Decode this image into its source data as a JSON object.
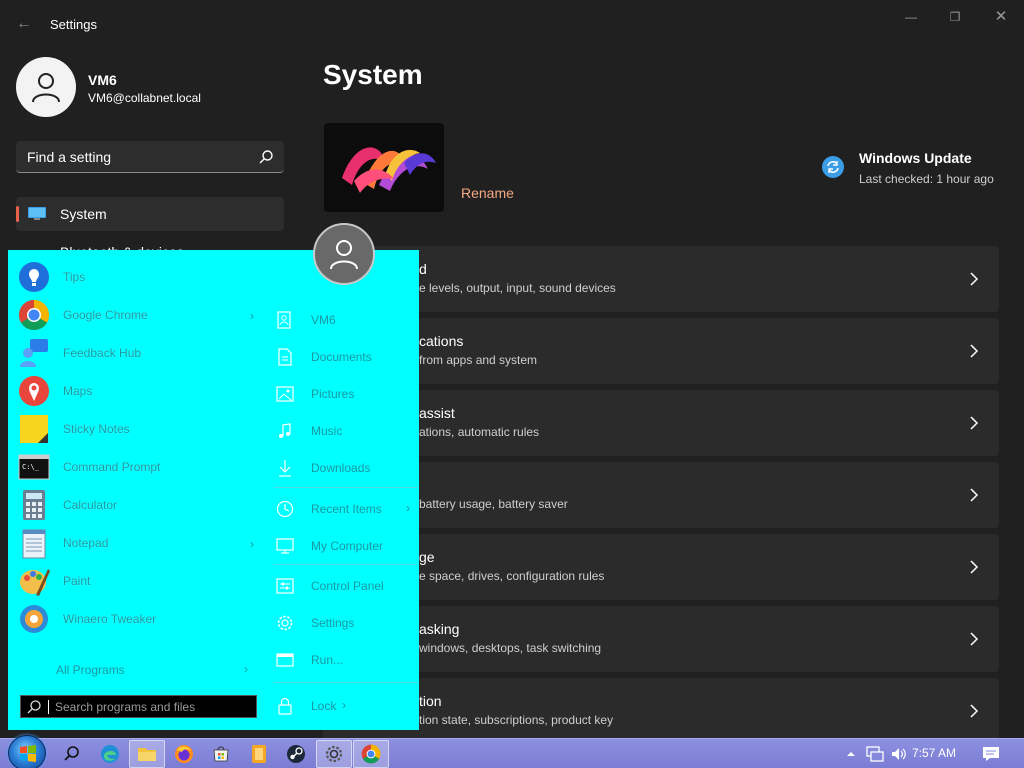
{
  "window": {
    "app_title": "Settings",
    "back_glyph": "←",
    "minimize_glyph": "—",
    "maximize_glyph": "❐",
    "close_glyph": "✕"
  },
  "profile": {
    "name": "VM6",
    "email": "VM6@collabnet.local"
  },
  "search": {
    "placeholder": "Find a setting"
  },
  "nav": {
    "selected": {
      "label": "System",
      "icon": "monitor-icon"
    },
    "next_partial": {
      "label": "Bluetooth & devices"
    }
  },
  "page": {
    "title": "System",
    "rename_label": "Rename",
    "windows_update": {
      "title": "Windows Update",
      "subtitle": "Last checked: 1 hour ago"
    }
  },
  "cards": [
    {
      "title": "d",
      "subtitle": "e levels, output, input, sound devices"
    },
    {
      "title": "cations",
      "subtitle": "from apps and system"
    },
    {
      "title": "assist",
      "subtitle": "ations, automatic rules"
    },
    {
      "title": "",
      "subtitle": "battery usage, battery saver"
    },
    {
      "title": "ge",
      "subtitle": "e space, drives, configuration rules"
    },
    {
      "title": "asking",
      "subtitle": "windows, desktops, task switching"
    },
    {
      "title": "tion",
      "subtitle": "tion state, subscriptions, product key"
    }
  ],
  "start_menu": {
    "pinned": [
      {
        "label": "Tips",
        "icon": "tips-icon",
        "has_arrow": false
      },
      {
        "label": "Google Chrome",
        "icon": "chrome-icon",
        "has_arrow": true
      },
      {
        "label": "Feedback Hub",
        "icon": "feedback-hub-icon",
        "has_arrow": false
      },
      {
        "label": "Maps",
        "icon": "maps-icon",
        "has_arrow": false
      },
      {
        "label": "Sticky Notes",
        "icon": "sticky-notes-icon",
        "has_arrow": false
      },
      {
        "label": "Command Prompt",
        "icon": "command-prompt-icon",
        "has_arrow": false
      },
      {
        "label": "Calculator",
        "icon": "calculator-icon",
        "has_arrow": false
      },
      {
        "label": "Notepad",
        "icon": "notepad-icon",
        "has_arrow": true
      },
      {
        "label": "Paint",
        "icon": "paint-icon",
        "has_arrow": false
      },
      {
        "label": "Winaero Tweaker",
        "icon": "winaero-tweaker-icon",
        "has_arrow": false
      }
    ],
    "all_programs": "All Programs",
    "search_placeholder": "Search programs and files",
    "arrow_glyph": "›",
    "right": [
      {
        "label": "VM6",
        "icon": "user-folder-icon"
      },
      {
        "label": "Documents",
        "icon": "documents-icon"
      },
      {
        "label": "Pictures",
        "icon": "pictures-icon"
      },
      {
        "label": "Music",
        "icon": "music-icon"
      },
      {
        "label": "Downloads",
        "icon": "downloads-icon"
      },
      {
        "label": "Recent Items",
        "icon": "recent-items-icon"
      },
      {
        "label": "My Computer",
        "icon": "computer-icon"
      },
      {
        "label": "Control Panel",
        "icon": "control-panel-icon"
      },
      {
        "label": "Settings",
        "icon": "settings-gear-icon"
      },
      {
        "label": "Run...",
        "icon": "run-icon"
      },
      {
        "label": "Lock",
        "icon": "lock-icon"
      }
    ]
  },
  "taskbar": {
    "clock": "7:57 AM",
    "apps": [
      "search-icon",
      "edge-icon",
      "file-explorer-icon",
      "firefox-icon",
      "store-icon",
      "notes-app-icon",
      "steam-icon",
      "settings-app-icon",
      "chrome-icon"
    ],
    "tray": [
      "show-hidden-icons",
      "network-icon",
      "volume-icon",
      "notification-icon"
    ]
  },
  "colors": {
    "accent": "#e8614a",
    "rename": "#f4a882",
    "start_menu_bg": "#00ffff",
    "start_menu_text": "#1a9aa2",
    "taskbar": "#8587dc"
  }
}
